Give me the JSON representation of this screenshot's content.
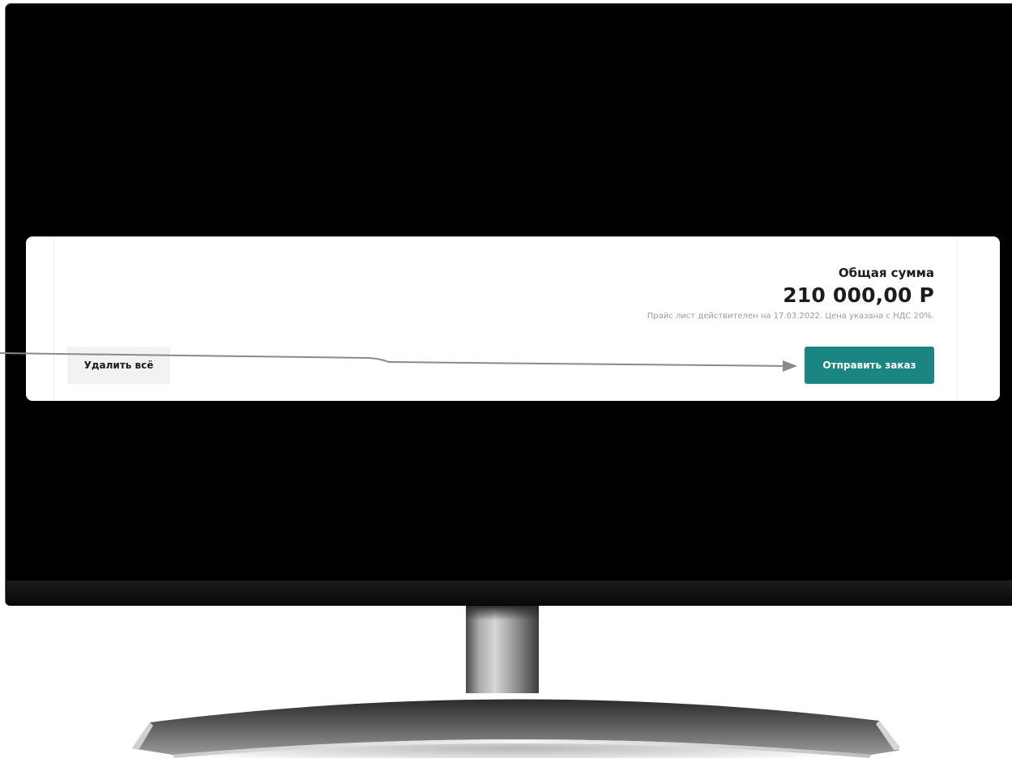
{
  "order_summary": {
    "total_label": "Общая сумма",
    "total_amount": "210 000,00 Р",
    "price_note": "Прайс лист действителен на 17.03.2022. Цена указана с НДС 20%."
  },
  "actions": {
    "delete_all_label": "Удалить всё",
    "send_order_label": "Отправить заказ"
  },
  "colors": {
    "accent": "#1a8581",
    "secondary_button_bg": "#f2f2f2",
    "screen_bg": "#000000",
    "annotation_arrow": "#8a8a8a"
  },
  "icons": {
    "annotation": "arrow-right-icon"
  }
}
